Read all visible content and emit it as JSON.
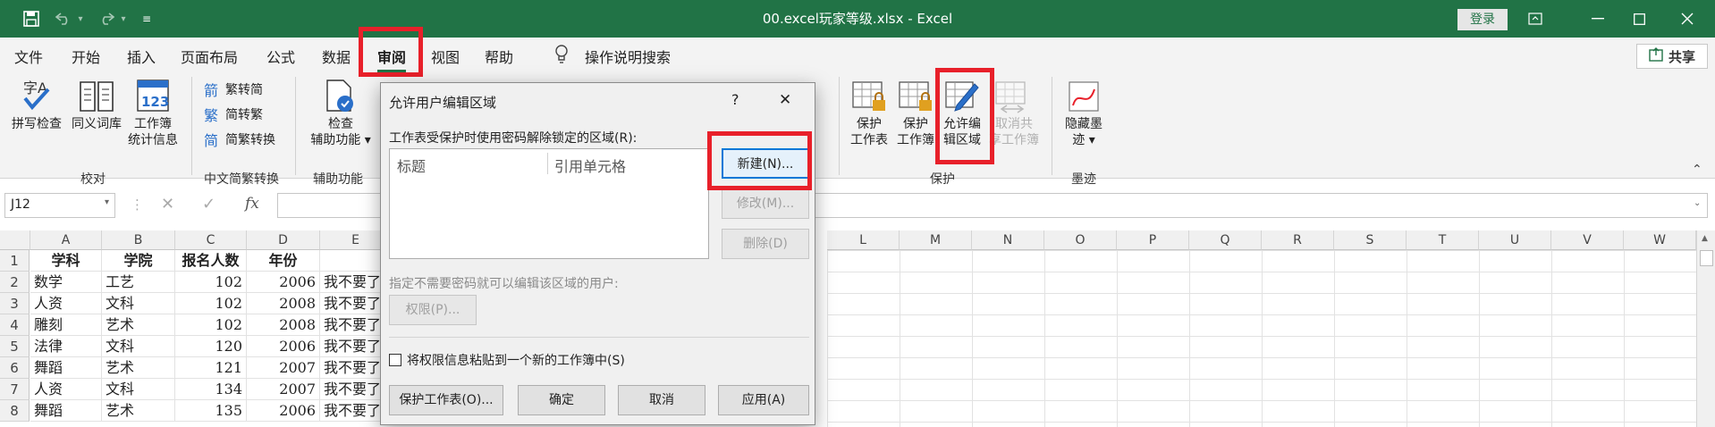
{
  "titlebar": {
    "title": "00.excel玩家等级.xlsx  -  Excel",
    "login_label": "登录"
  },
  "menu": {
    "tabs": [
      "文件",
      "开始",
      "插入",
      "页面布局",
      "公式",
      "数据",
      "审阅",
      "视图",
      "帮助"
    ],
    "active_tab": "审阅",
    "search_label": "操作说明搜索",
    "share_label": "共享"
  },
  "ribbon": {
    "spell_label": "拼写检查",
    "thesaurus_label": "同义词库",
    "workbook_stats_label_1": "工作簿",
    "workbook_stats_label_2": "统计信息",
    "group_proofing": "校对",
    "trad_label": "繁转简",
    "simp_label": "简转繁",
    "convert_label": "简繁转换",
    "group_chinese": "中文简繁转换",
    "check_label_1": "检查",
    "check_label_2": "辅助功能",
    "group_accessibility": "辅助功能",
    "protect_sheet_label_1": "保护",
    "protect_sheet_label_2": "工作表",
    "protect_wb_label_1": "保护",
    "protect_wb_label_2": "工作簿",
    "allow_edit_label_1": "允许编",
    "allow_edit_label_2": "辑区域",
    "unshare_label_1": "取消共",
    "unshare_label_2": "享工作簿",
    "group_protect": "保护",
    "hide_ink_label_1": "隐藏墨",
    "hide_ink_label_2": "迹",
    "group_ink": "墨迹"
  },
  "formula_bar": {
    "cell_ref": "J12",
    "fx": "fx",
    "formula": ""
  },
  "grid": {
    "columns_left": [
      "A",
      "B",
      "C",
      "D",
      "E"
    ],
    "columns_right": [
      "L",
      "M",
      "N",
      "O",
      "P",
      "Q",
      "R",
      "S",
      "T",
      "U",
      "V",
      "W"
    ],
    "row_numbers": [
      "1",
      "2",
      "3",
      "4",
      "5",
      "6",
      "7",
      "8"
    ],
    "header": [
      "学科",
      "学院",
      "报名人数",
      "年份"
    ],
    "rows": [
      {
        "subject": "数学",
        "college": "工艺",
        "count": "102",
        "year": "2006",
        "note": "我不要了"
      },
      {
        "subject": "人资",
        "college": "文科",
        "count": "102",
        "year": "2008",
        "note": "我不要了"
      },
      {
        "subject": "雕刻",
        "college": "艺术",
        "count": "102",
        "year": "2008",
        "note": "我不要了"
      },
      {
        "subject": "法律",
        "college": "文科",
        "count": "120",
        "year": "2006",
        "note": "我不要了"
      },
      {
        "subject": "舞蹈",
        "college": "艺术",
        "count": "121",
        "year": "2007",
        "note": "我不要了"
      },
      {
        "subject": "人资",
        "college": "文科",
        "count": "134",
        "year": "2007",
        "note": "我不要了"
      },
      {
        "subject": "舞蹈",
        "college": "艺术",
        "count": "135",
        "year": "2006",
        "note": "我不要了"
      }
    ]
  },
  "dialog": {
    "title": "允许用户编辑区域",
    "help": "?",
    "close": "✕",
    "locked_ranges_label": "工作表受保护时使用密码解除锁定的区域(R):",
    "list_col_title": "标题",
    "list_col_ref": "引用单元格",
    "new_button": "新建(N)...",
    "modify_button": "修改(M)...",
    "delete_button": "删除(D)",
    "users_label": "指定不需要密码就可以编辑该区域的用户:",
    "permissions_button": "权限(P)...",
    "paste_checkbox_label": "将权限信息粘贴到一个新的工作簿中(S)",
    "protect_sheet_button": "保护工作表(O)...",
    "ok_button": "确定",
    "cancel_button": "取消",
    "apply_button": "应用(A)"
  },
  "colors": {
    "excel_green": "#217346",
    "highlight_red": "#e8202a",
    "dialog_bg": "#f0f0f0"
  }
}
